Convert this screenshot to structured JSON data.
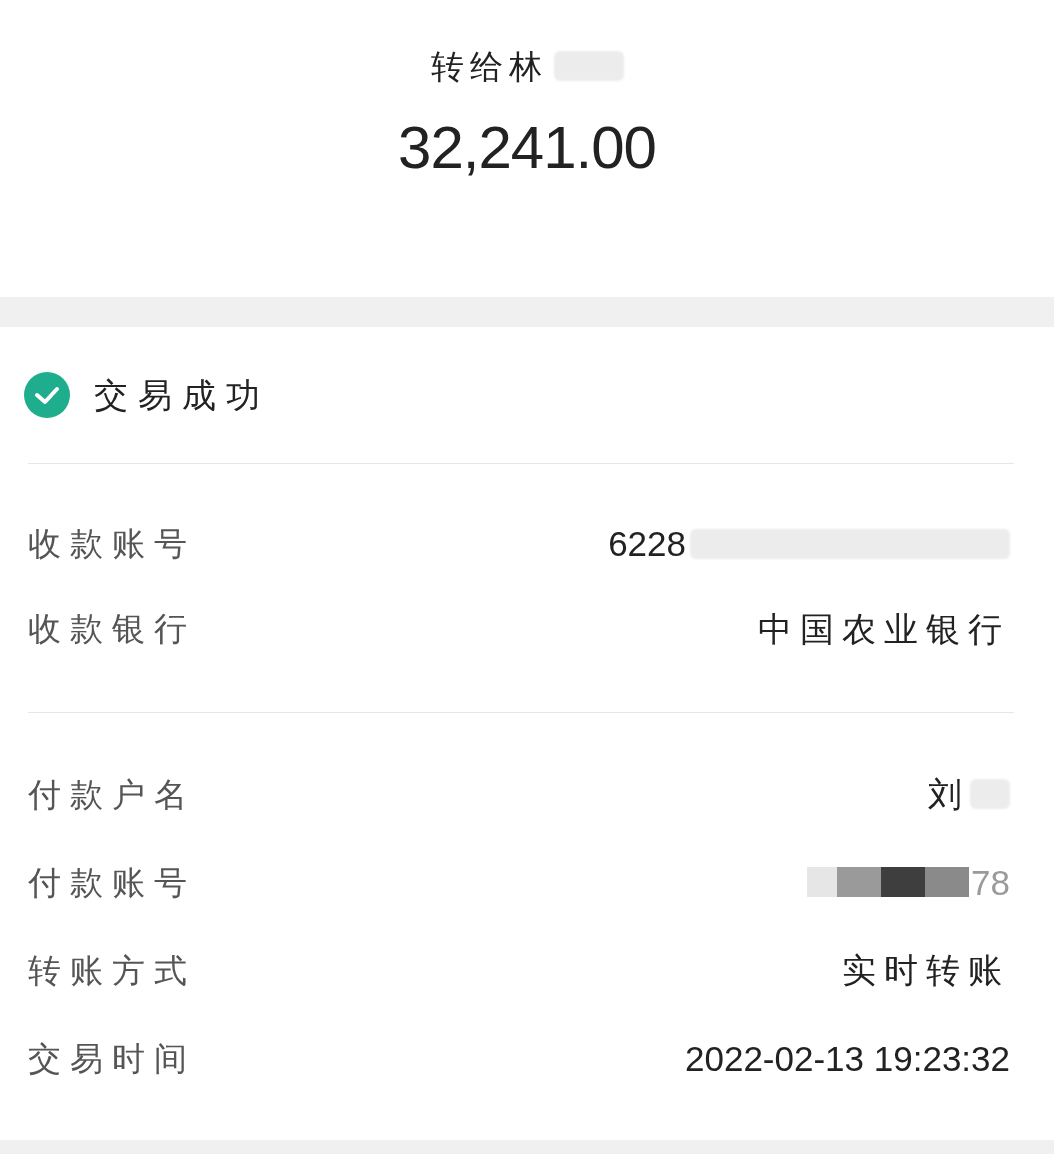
{
  "header": {
    "recipient": "转给林",
    "blurred": true,
    "amount": "32,241.00"
  },
  "status": {
    "kind": "success",
    "label": "交易成功"
  },
  "sections": [
    {
      "rows": [
        {
          "label": "收款账号",
          "value": "6228",
          "blurred": true
        },
        {
          "label": "收款银行",
          "value": "中国农业银行"
        }
      ]
    },
    {
      "rows": [
        {
          "label": "付款户名",
          "value": "刘",
          "blurred": true
        },
        {
          "label": "付款账号",
          "value": "78",
          "mosaic": true
        },
        {
          "label": "转账方式",
          "value": "实时转账"
        },
        {
          "label": "交易时间",
          "value": "2022-02-13 19:23:32"
        }
      ]
    }
  ]
}
